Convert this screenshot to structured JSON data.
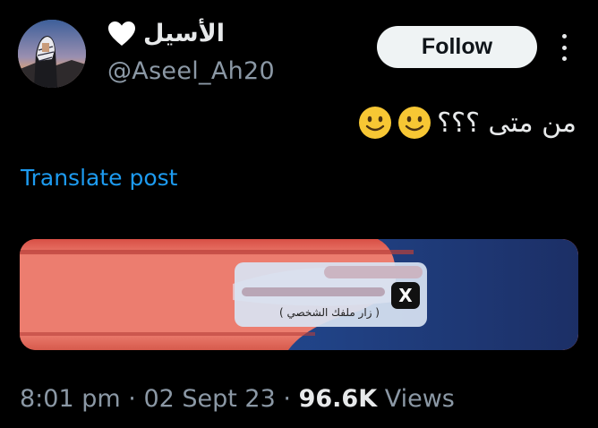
{
  "author": {
    "display_name": "الأسيل",
    "handle": "@Aseel_Ah20",
    "heart_emoji": "🤍"
  },
  "follow_button": {
    "label": "Follow"
  },
  "post": {
    "text": "من متى ؟؟؟",
    "emojis": [
      "🙂",
      "🙂"
    ]
  },
  "translate_link": {
    "label": "Translate post"
  },
  "media": {
    "notification_text": "( زار ملفك الشخصي )",
    "app_logo": "X"
  },
  "meta": {
    "time": "8:01 pm",
    "separator": "·",
    "date": "02 Sept 23",
    "views_count": "96.6K",
    "views_label": "Views"
  },
  "colors": {
    "background": "#000000",
    "text": "#e7e9ea",
    "secondary": "#8b98a5",
    "link": "#1d9bf0",
    "follow_bg": "#eff3f4",
    "media_red": "#e67265",
    "media_blue": "#1e3a78"
  },
  "icons": {
    "more": "more-vertical-icon",
    "heart": "white-heart-icon",
    "smiley": "slightly-smiling-face-icon"
  }
}
